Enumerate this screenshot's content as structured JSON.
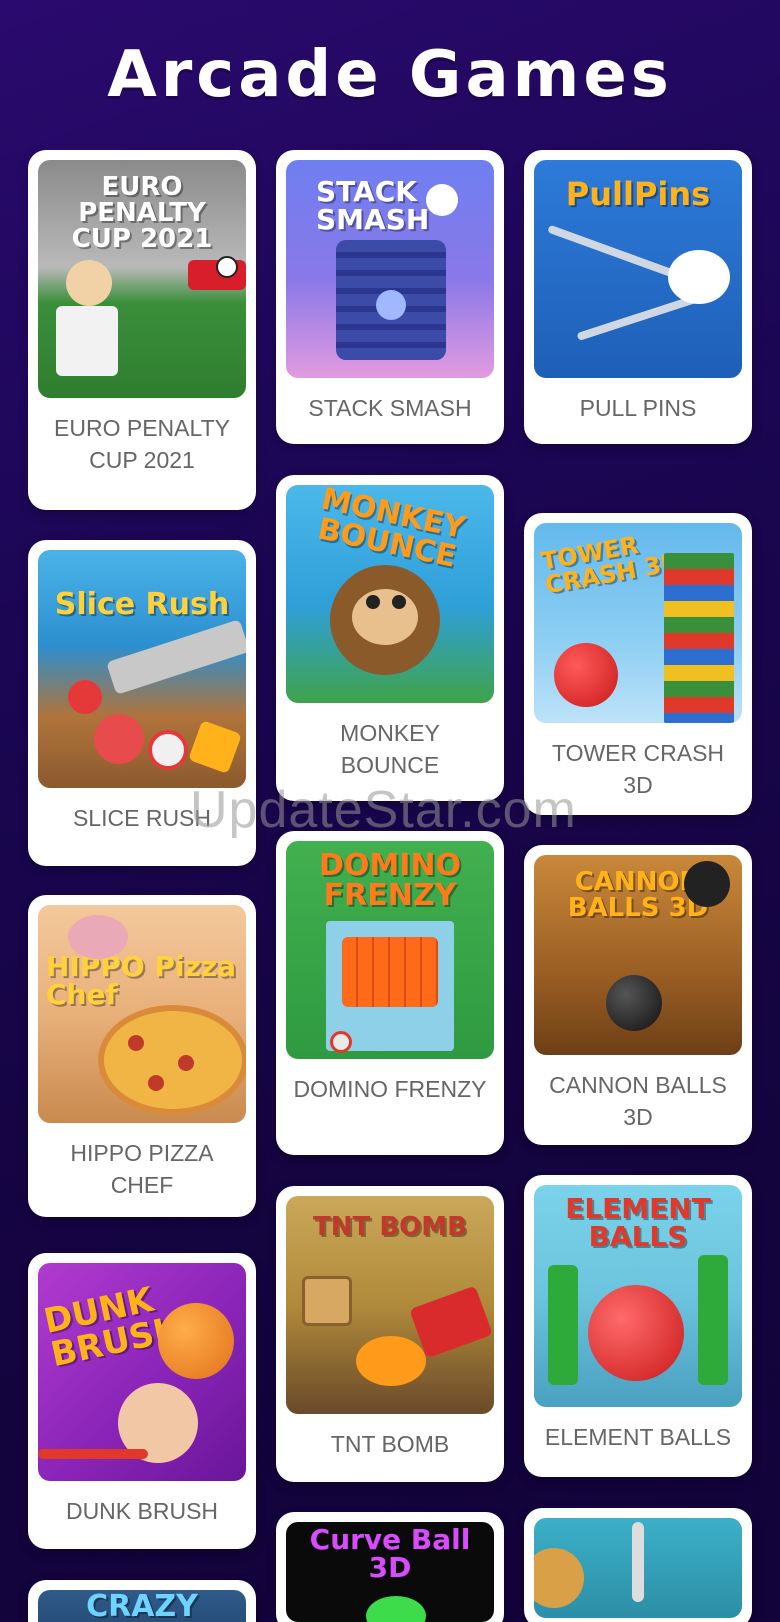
{
  "page": {
    "title": "Arcade Games"
  },
  "watermark": "UpdateStar.com",
  "games": [
    {
      "label": "EURO PENALTY CUP 2021",
      "logo": "EURO PENALTY CUP 2021"
    },
    {
      "label": "STACK SMASH",
      "logo": "STACK SMASH"
    },
    {
      "label": "PULL PINS",
      "logo": "PullPins"
    },
    {
      "label": "SLICE RUSH",
      "logo": "Slice Rush"
    },
    {
      "label": "MONKEY BOUNCE",
      "logo": "MONKEY BOUNCE"
    },
    {
      "label": "TOWER CRASH 3D",
      "logo": "TOWER CRASH 3D"
    },
    {
      "label": "HIPPO PIZZA CHEF",
      "logo": "HIPPO Pizza Chef"
    },
    {
      "label": "DOMINO FRENZY",
      "logo": "DOMINO FRENZY"
    },
    {
      "label": "CANNON BALLS 3D",
      "logo": "CANNON BALLS 3D"
    },
    {
      "label": "DUNK BRUSH",
      "logo": "DUNK BRUSH"
    },
    {
      "label": "TNT BOMB",
      "logo": "TNT BOMB"
    },
    {
      "label": "ELEMENT BALLS",
      "logo": "ELEMENT BALLS"
    },
    {
      "label": "",
      "logo": "CRAZY"
    },
    {
      "label": "",
      "logo": "Curve Ball 3D"
    },
    {
      "label": "",
      "logo": ""
    }
  ]
}
